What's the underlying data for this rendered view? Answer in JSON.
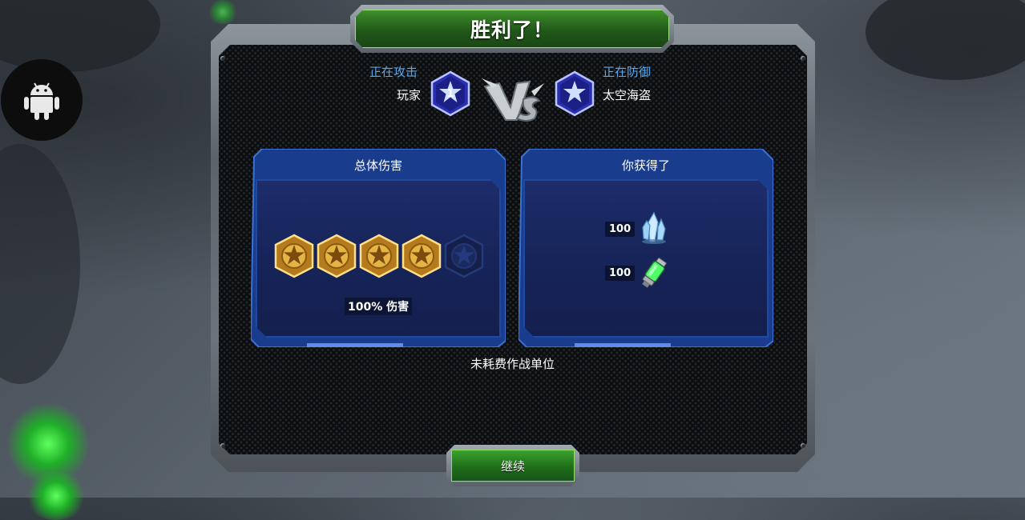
{
  "title": "胜利了！",
  "attacker": {
    "label": "正在攻击",
    "name": "玩家",
    "rank": "1"
  },
  "defender": {
    "label": "正在防御",
    "name": "太空海盗"
  },
  "damage_panel": {
    "title": "总体伤害",
    "stars_earned": 4,
    "stars_total": 5,
    "damage_text": "100% 伤害"
  },
  "rewards_panel": {
    "title": "你获得了",
    "items": [
      {
        "amount": "100",
        "icon": "crystal-icon"
      },
      {
        "amount": "100",
        "icon": "gas-canister-icon"
      }
    ]
  },
  "note": "未耗费作战单位",
  "continue_label": "继续",
  "colors": {
    "accent_green": "#21581a",
    "panel_blue": "#17245a",
    "label_blue": "#59a8ee",
    "gold": "#d4a436"
  }
}
